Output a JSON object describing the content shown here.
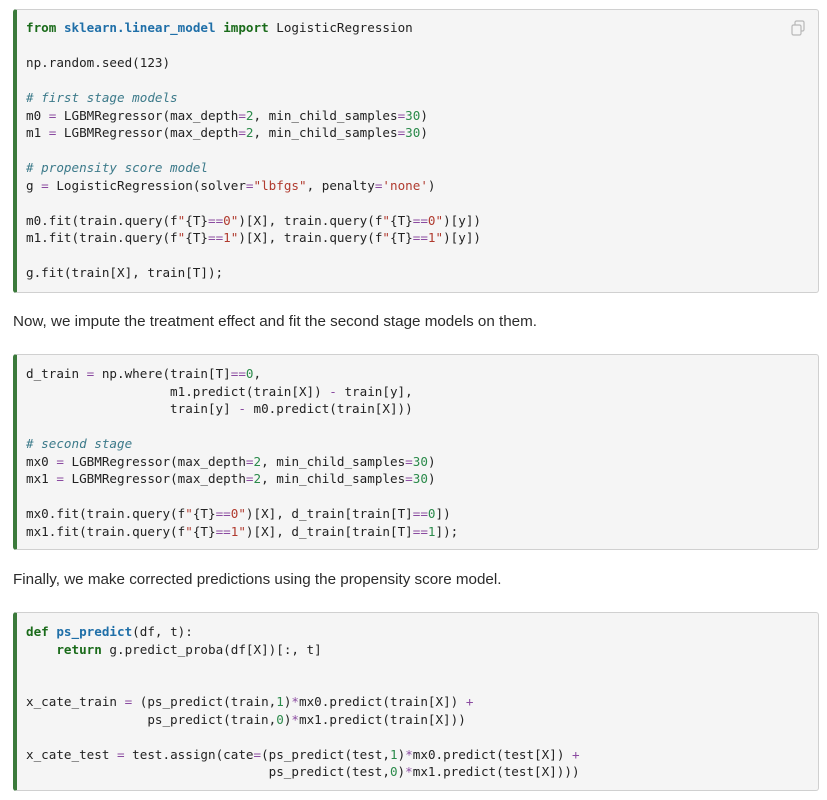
{
  "block1": {
    "lines": [
      [
        [
          "kw",
          "from"
        ],
        [
          "t",
          " "
        ],
        [
          "mod",
          "sklearn.linear_model"
        ],
        [
          "t",
          " "
        ],
        [
          "kw",
          "import"
        ],
        [
          "t",
          " LogisticRegression"
        ]
      ],
      [],
      [
        [
          "t",
          "np.random.seed(123)"
        ]
      ],
      [],
      [
        [
          "cm",
          "# first stage models"
        ]
      ],
      [
        [
          "t",
          "m0 "
        ],
        [
          "op",
          "="
        ],
        [
          "t",
          " LGBMRegressor(max_depth"
        ],
        [
          "op",
          "="
        ],
        [
          "num",
          "2"
        ],
        [
          "t",
          ", min_child_samples"
        ],
        [
          "op",
          "="
        ],
        [
          "num",
          "30"
        ],
        [
          "t",
          ")"
        ]
      ],
      [
        [
          "t",
          "m1 "
        ],
        [
          "op",
          "="
        ],
        [
          "t",
          " LGBMRegressor(max_depth"
        ],
        [
          "op",
          "="
        ],
        [
          "num",
          "2"
        ],
        [
          "t",
          ", min_child_samples"
        ],
        [
          "op",
          "="
        ],
        [
          "num",
          "30"
        ],
        [
          "t",
          ")"
        ]
      ],
      [],
      [
        [
          "cm",
          "# propensity score model"
        ]
      ],
      [
        [
          "t",
          "g "
        ],
        [
          "op",
          "="
        ],
        [
          "t",
          " LogisticRegression(solver"
        ],
        [
          "op",
          "="
        ],
        [
          "str",
          "\"lbfgs\""
        ],
        [
          "t",
          ", penalty"
        ],
        [
          "op",
          "="
        ],
        [
          "str",
          "'none'"
        ],
        [
          "t",
          ")"
        ]
      ],
      [],
      [
        [
          "t",
          "m0.fit(train.query(f"
        ],
        [
          "str",
          "\""
        ],
        [
          "t",
          "{T}"
        ],
        [
          "op",
          "=="
        ],
        [
          "str",
          "0\""
        ],
        [
          "t",
          ")[X], train.query(f"
        ],
        [
          "str",
          "\""
        ],
        [
          "t",
          "{T}"
        ],
        [
          "op",
          "=="
        ],
        [
          "str",
          "0\""
        ],
        [
          "t",
          ")[y])"
        ]
      ],
      [
        [
          "t",
          "m1.fit(train.query(f"
        ],
        [
          "str",
          "\""
        ],
        [
          "t",
          "{T}"
        ],
        [
          "op",
          "=="
        ],
        [
          "str",
          "1\""
        ],
        [
          "t",
          ")[X], train.query(f"
        ],
        [
          "str",
          "\""
        ],
        [
          "t",
          "{T}"
        ],
        [
          "op",
          "=="
        ],
        [
          "str",
          "1\""
        ],
        [
          "t",
          ")[y])"
        ]
      ],
      [],
      [
        [
          "t",
          "g.fit(train[X], train[T]);"
        ]
      ]
    ]
  },
  "prose1": "Now, we impute the treatment effect and fit the second stage models on them.",
  "block2": {
    "lines": [
      [
        [
          "t",
          "d_train "
        ],
        [
          "op",
          "="
        ],
        [
          "t",
          " np.where(train[T]"
        ],
        [
          "op",
          "=="
        ],
        [
          "num",
          "0"
        ],
        [
          "t",
          ","
        ]
      ],
      [
        [
          "t",
          "                   m1.predict(train[X]) "
        ],
        [
          "op",
          "-"
        ],
        [
          "t",
          " train[y],"
        ]
      ],
      [
        [
          "t",
          "                   train[y] "
        ],
        [
          "op",
          "-"
        ],
        [
          "t",
          " m0.predict(train[X]))"
        ]
      ],
      [],
      [
        [
          "cm",
          "# second stage"
        ]
      ],
      [
        [
          "t",
          "mx0 "
        ],
        [
          "op",
          "="
        ],
        [
          "t",
          " LGBMRegressor(max_depth"
        ],
        [
          "op",
          "="
        ],
        [
          "num",
          "2"
        ],
        [
          "t",
          ", min_child_samples"
        ],
        [
          "op",
          "="
        ],
        [
          "num",
          "30"
        ],
        [
          "t",
          ")"
        ]
      ],
      [
        [
          "t",
          "mx1 "
        ],
        [
          "op",
          "="
        ],
        [
          "t",
          " LGBMRegressor(max_depth"
        ],
        [
          "op",
          "="
        ],
        [
          "num",
          "2"
        ],
        [
          "t",
          ", min_child_samples"
        ],
        [
          "op",
          "="
        ],
        [
          "num",
          "30"
        ],
        [
          "t",
          ")"
        ]
      ],
      [],
      [
        [
          "t",
          "mx0.fit(train.query(f"
        ],
        [
          "str",
          "\""
        ],
        [
          "t",
          "{T}"
        ],
        [
          "op",
          "=="
        ],
        [
          "str",
          "0\""
        ],
        [
          "t",
          ")[X], d_train[train[T]"
        ],
        [
          "op",
          "=="
        ],
        [
          "num",
          "0"
        ],
        [
          "t",
          "])"
        ]
      ],
      [
        [
          "t",
          "mx1.fit(train.query(f"
        ],
        [
          "str",
          "\""
        ],
        [
          "t",
          "{T}"
        ],
        [
          "op",
          "=="
        ],
        [
          "str",
          "1\""
        ],
        [
          "t",
          ")[X], d_train[train[T]"
        ],
        [
          "op",
          "=="
        ],
        [
          "num",
          "1"
        ],
        [
          "t",
          "]);"
        ]
      ]
    ]
  },
  "prose2": "Finally, we make corrected predictions using the propensity score model.",
  "block3": {
    "lines": [
      [
        [
          "kw",
          "def"
        ],
        [
          "t",
          " "
        ],
        [
          "mod",
          "ps_predict"
        ],
        [
          "t",
          "(df, t):"
        ]
      ],
      [
        [
          "t",
          "    "
        ],
        [
          "kw",
          "return"
        ],
        [
          "t",
          " g.predict_proba(df[X])[:, t]"
        ]
      ],
      [],
      [],
      [
        [
          "t",
          "x_cate_train "
        ],
        [
          "op",
          "="
        ],
        [
          "t",
          " (ps_predict(train,"
        ],
        [
          "num",
          "1"
        ],
        [
          "t",
          ")"
        ],
        [
          "op",
          "*"
        ],
        [
          "t",
          "mx0.predict(train[X]) "
        ],
        [
          "op",
          "+"
        ]
      ],
      [
        [
          "t",
          "                ps_predict(train,"
        ],
        [
          "num",
          "0"
        ],
        [
          "t",
          ")"
        ],
        [
          "op",
          "*"
        ],
        [
          "t",
          "mx1.predict(train[X]))"
        ]
      ],
      [],
      [
        [
          "t",
          "x_cate_test "
        ],
        [
          "op",
          "="
        ],
        [
          "t",
          " test.assign(cate"
        ],
        [
          "op",
          "="
        ],
        [
          "t",
          "(ps_predict(test,"
        ],
        [
          "num",
          "1"
        ],
        [
          "t",
          ")"
        ],
        [
          "op",
          "*"
        ],
        [
          "t",
          "mx0.predict(test[X]) "
        ],
        [
          "op",
          "+"
        ]
      ],
      [
        [
          "t",
          "                                ps_predict(test,"
        ],
        [
          "num",
          "0"
        ],
        [
          "t",
          ")"
        ],
        [
          "op",
          "*"
        ],
        [
          "t",
          "mx1.predict(test[X])))"
        ]
      ]
    ]
  },
  "icons": {
    "copy": "copy-icon"
  }
}
